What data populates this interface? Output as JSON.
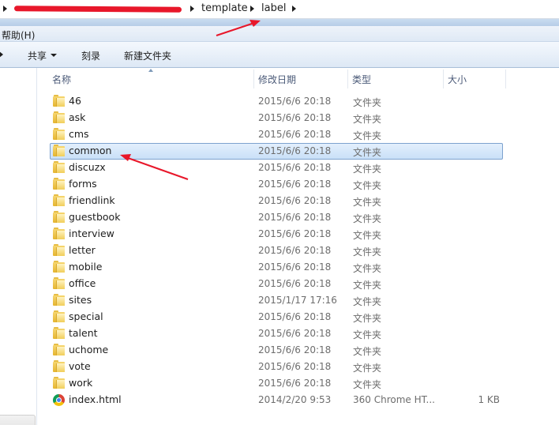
{
  "address_bar": {
    "crumbs": [
      "template",
      "label"
    ]
  },
  "menu": {
    "help": "帮助(H)"
  },
  "toolbar": {
    "share": "共享",
    "burn": "刻录",
    "new_folder": "新建文件夹"
  },
  "columns": {
    "name": "名称",
    "modified": "修改日期",
    "type": "类型",
    "size": "大小"
  },
  "files": [
    {
      "name": "46",
      "date": "2015/6/6 20:18",
      "type": "文件夹",
      "size": "",
      "icon": "folder-icon"
    },
    {
      "name": "ask",
      "date": "2015/6/6 20:18",
      "type": "文件夹",
      "size": "",
      "icon": "folder-icon"
    },
    {
      "name": "cms",
      "date": "2015/6/6 20:18",
      "type": "文件夹",
      "size": "",
      "icon": "folder-icon"
    },
    {
      "name": "common",
      "date": "2015/6/6 20:18",
      "type": "文件夹",
      "size": "",
      "icon": "folder-icon",
      "selected": true
    },
    {
      "name": "discuzx",
      "date": "2015/6/6 20:18",
      "type": "文件夹",
      "size": "",
      "icon": "folder-icon"
    },
    {
      "name": "forms",
      "date": "2015/6/6 20:18",
      "type": "文件夹",
      "size": "",
      "icon": "folder-icon"
    },
    {
      "name": "friendlink",
      "date": "2015/6/6 20:18",
      "type": "文件夹",
      "size": "",
      "icon": "folder-icon"
    },
    {
      "name": "guestbook",
      "date": "2015/6/6 20:18",
      "type": "文件夹",
      "size": "",
      "icon": "folder-icon"
    },
    {
      "name": "interview",
      "date": "2015/6/6 20:18",
      "type": "文件夹",
      "size": "",
      "icon": "folder-icon"
    },
    {
      "name": "letter",
      "date": "2015/6/6 20:18",
      "type": "文件夹",
      "size": "",
      "icon": "folder-icon"
    },
    {
      "name": "mobile",
      "date": "2015/6/6 20:18",
      "type": "文件夹",
      "size": "",
      "icon": "folder-icon"
    },
    {
      "name": "office",
      "date": "2015/6/6 20:18",
      "type": "文件夹",
      "size": "",
      "icon": "folder-icon"
    },
    {
      "name": "sites",
      "date": "2015/1/17 17:16",
      "type": "文件夹",
      "size": "",
      "icon": "folder-icon"
    },
    {
      "name": "special",
      "date": "2015/6/6 20:18",
      "type": "文件夹",
      "size": "",
      "icon": "folder-icon"
    },
    {
      "name": "talent",
      "date": "2015/6/6 20:18",
      "type": "文件夹",
      "size": "",
      "icon": "folder-icon"
    },
    {
      "name": "uchome",
      "date": "2015/6/6 20:18",
      "type": "文件夹",
      "size": "",
      "icon": "folder-icon"
    },
    {
      "name": "vote",
      "date": "2015/6/6 20:18",
      "type": "文件夹",
      "size": "",
      "icon": "folder-icon"
    },
    {
      "name": "work",
      "date": "2015/6/6 20:18",
      "type": "文件夹",
      "size": "",
      "icon": "folder-icon"
    },
    {
      "name": "index.html",
      "date": "2014/2/20 9:53",
      "type": "360 Chrome HT...",
      "size": "1 KB",
      "icon": "chrome-html-icon"
    }
  ],
  "colors": {
    "annotation": "#e8172a",
    "selection_border": "#7da2ce",
    "folder": "#f1ce5a"
  }
}
